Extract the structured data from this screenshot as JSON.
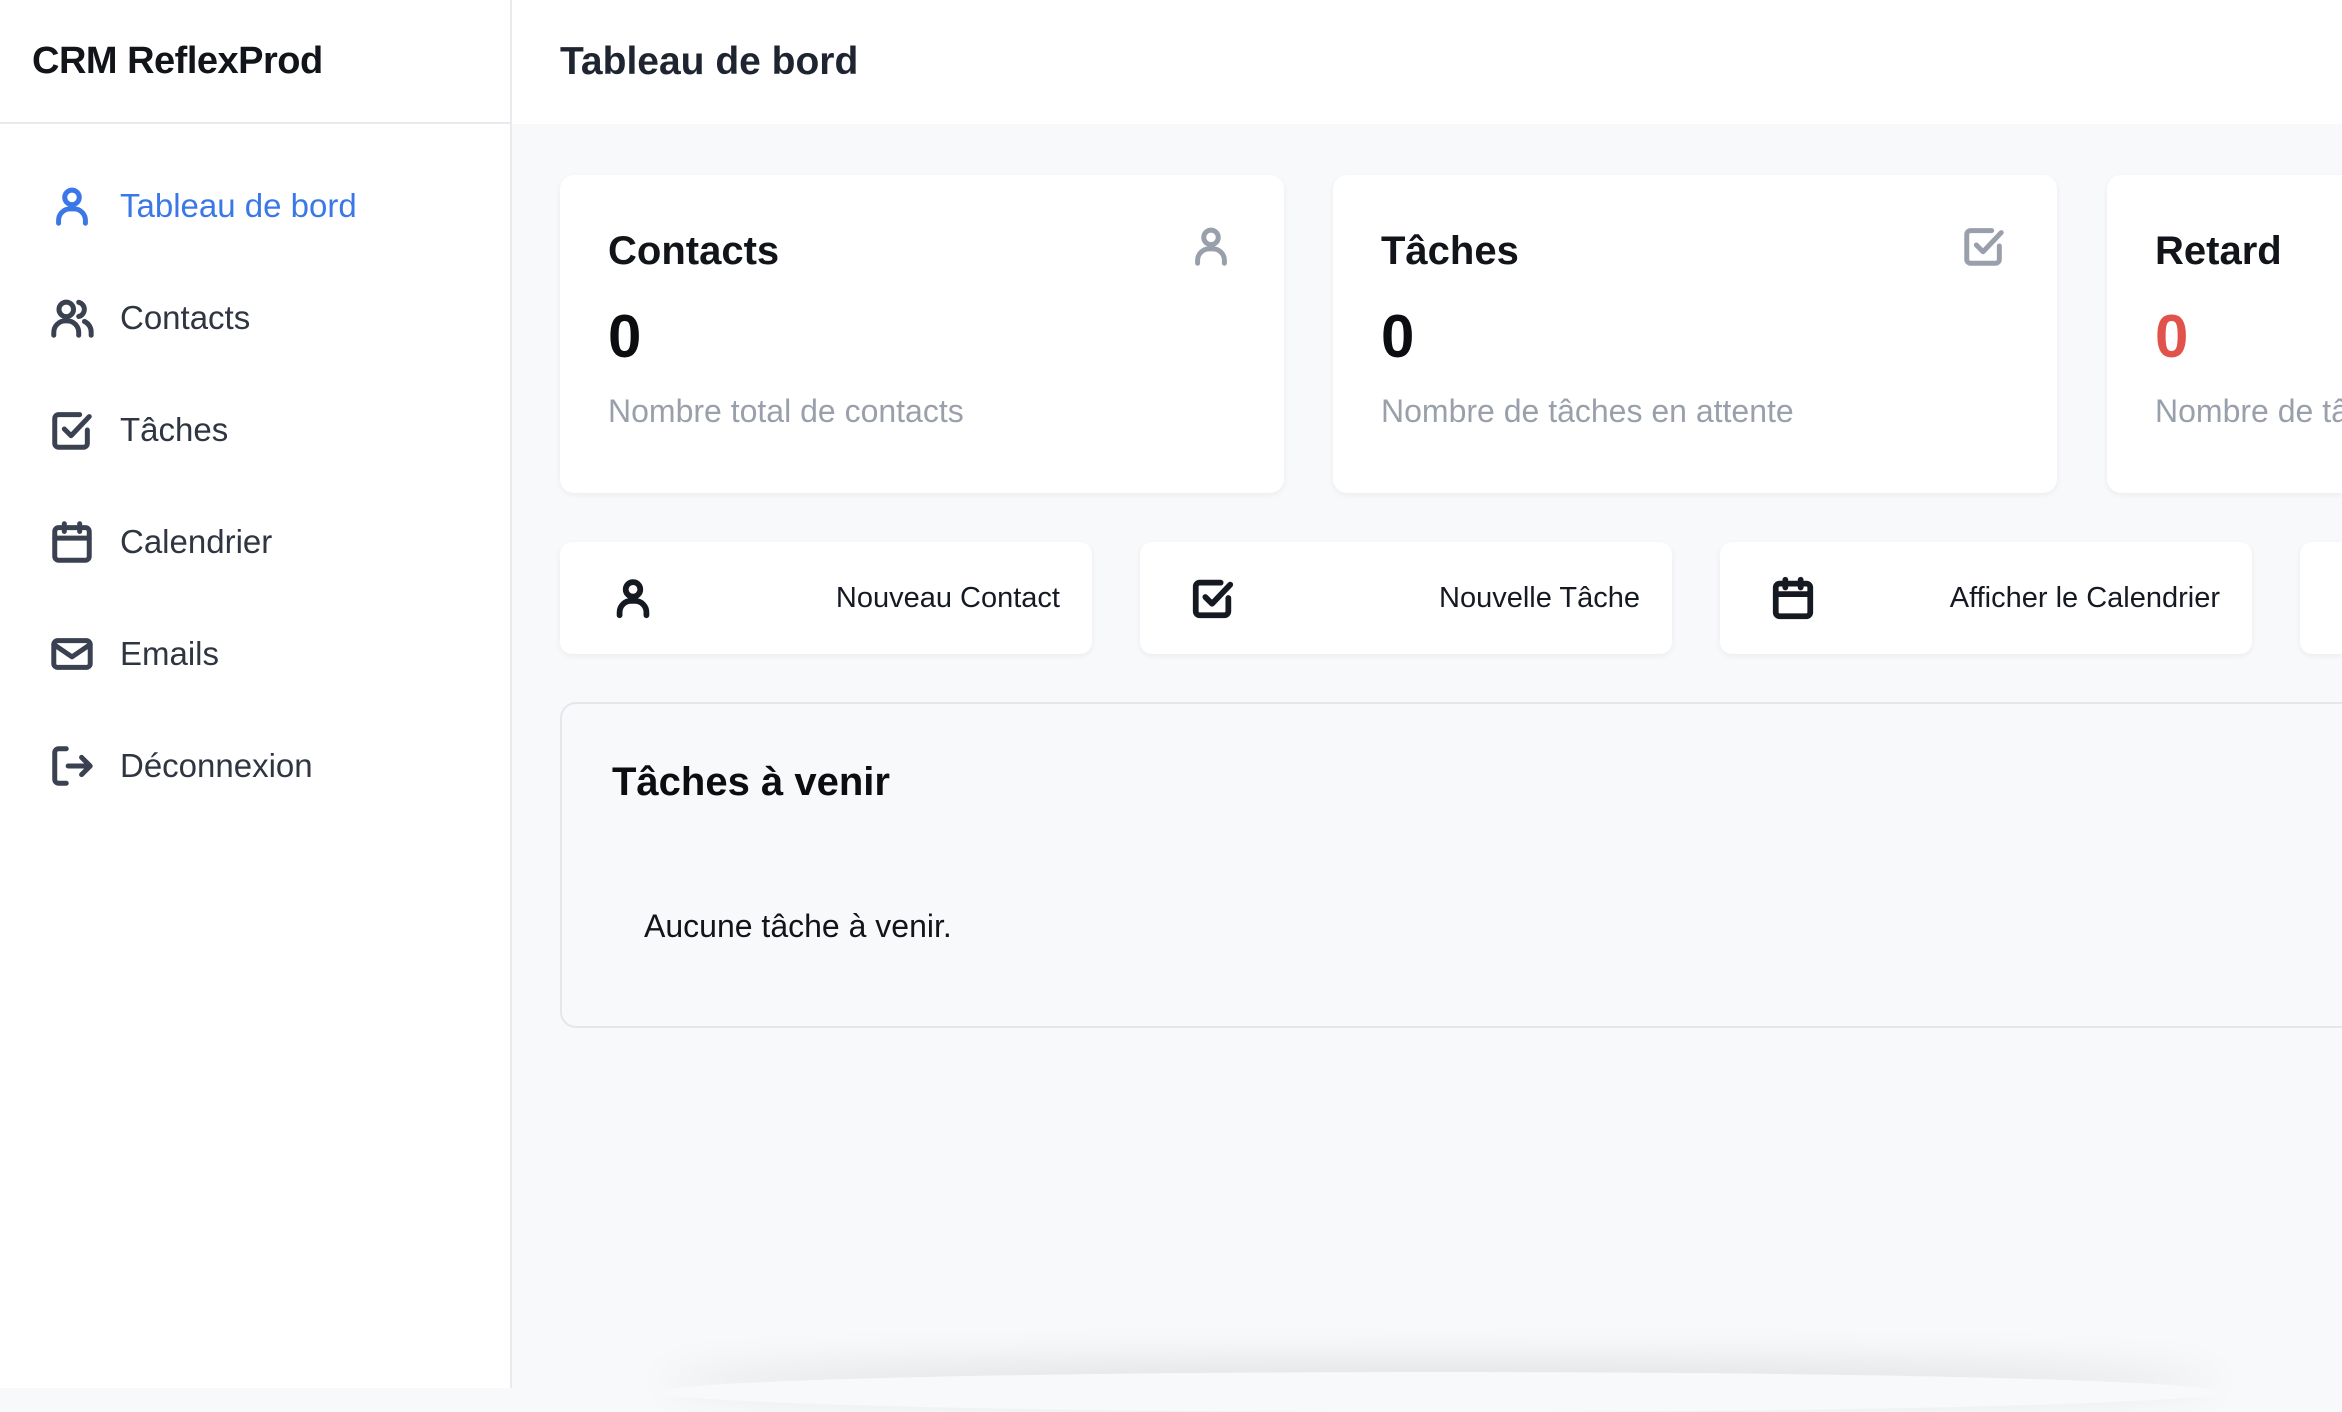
{
  "app": {
    "brand": "CRM ReflexProd"
  },
  "header": {
    "title": "Tableau de bord"
  },
  "sidebar": {
    "items": [
      {
        "label": "Tableau de bord",
        "icon": "user-icon",
        "active": true
      },
      {
        "label": "Contacts",
        "icon": "users-icon"
      },
      {
        "label": "Tâches",
        "icon": "check-square-icon"
      },
      {
        "label": "Calendrier",
        "icon": "calendar-icon"
      },
      {
        "label": "Emails",
        "icon": "mail-icon"
      },
      {
        "label": "Déconnexion",
        "icon": "logout-icon"
      }
    ]
  },
  "stats": [
    {
      "title": "Contacts",
      "value": "0",
      "description": "Nombre total de contacts",
      "icon": "user-icon"
    },
    {
      "title": "Tâches",
      "value": "0",
      "description": "Nombre de tâches en attente",
      "icon": "check-square-icon"
    },
    {
      "title": "Retard",
      "value": "0",
      "description": "Nombre de tâ",
      "value_color": "#e0524a"
    }
  ],
  "actions": [
    {
      "label": "Nouveau Contact",
      "icon": "user-icon"
    },
    {
      "label": "Nouvelle Tâche",
      "icon": "check-square-icon"
    },
    {
      "label": "Afficher le Calendrier",
      "icon": "calendar-icon"
    }
  ],
  "upcoming": {
    "title": "Tâches à venir",
    "empty_message": "Aucune tâche à venir."
  },
  "colors": {
    "accent": "#3b78e7",
    "danger": "#e0524a",
    "muted": "#9aa0ab"
  }
}
